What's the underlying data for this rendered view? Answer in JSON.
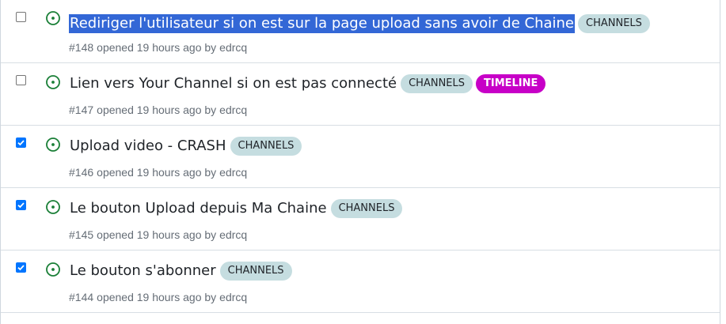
{
  "colors": {
    "open_icon": "#1a7f37",
    "label_channels_bg": "#c5dde0",
    "label_channels_fg": "#1f2328",
    "label_timeline_bg": "#c700c7",
    "label_timeline_fg": "#ffffff",
    "selection": "#3367d6",
    "checkbox_checked": "#0075ff"
  },
  "issues": [
    {
      "title": "Rediriger l'utilisateur si on est sur la page upload sans avoir de Chaine",
      "number": "#148",
      "opened_text": "opened 19 hours ago by",
      "author": "edrcq",
      "checked": false,
      "selected": true,
      "labels": [
        {
          "text": "CHANNELS",
          "kind": "channels"
        }
      ]
    },
    {
      "title": "Lien vers Your Channel si on est pas connecté",
      "number": "#147",
      "opened_text": "opened 19 hours ago by",
      "author": "edrcq",
      "checked": false,
      "selected": false,
      "labels": [
        {
          "text": "CHANNELS",
          "kind": "channels"
        },
        {
          "text": "TIMELINE",
          "kind": "timeline"
        }
      ]
    },
    {
      "title": "Upload video - CRASH",
      "number": "#146",
      "opened_text": "opened 19 hours ago by",
      "author": "edrcq",
      "checked": true,
      "selected": false,
      "labels": [
        {
          "text": "CHANNELS",
          "kind": "channels"
        }
      ]
    },
    {
      "title": "Le bouton Upload depuis Ma Chaine",
      "number": "#145",
      "opened_text": "opened 19 hours ago by",
      "author": "edrcq",
      "checked": true,
      "selected": false,
      "labels": [
        {
          "text": "CHANNELS",
          "kind": "channels"
        }
      ]
    },
    {
      "title": "Le bouton s'abonner",
      "number": "#144",
      "opened_text": "opened 19 hours ago by",
      "author": "edrcq",
      "checked": true,
      "selected": false,
      "labels": [
        {
          "text": "CHANNELS",
          "kind": "channels"
        }
      ]
    }
  ]
}
